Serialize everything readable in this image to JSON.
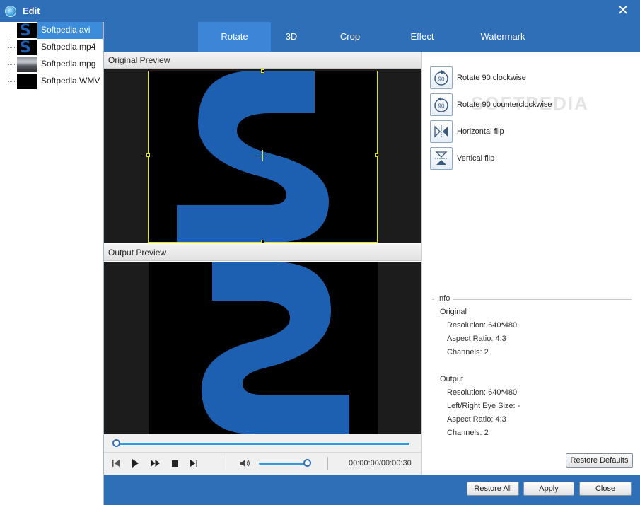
{
  "window": {
    "title": "Edit",
    "close_label": "✕"
  },
  "files": [
    {
      "name": "Softpedia.avi",
      "selected": true,
      "thumb": "s-logo"
    },
    {
      "name": "Softpedia.mp4",
      "selected": false,
      "thumb": "s-logo"
    },
    {
      "name": "Softpedia.mpg",
      "selected": false,
      "thumb": "crowd"
    },
    {
      "name": "Softpedia.WMV",
      "selected": false,
      "thumb": "black"
    }
  ],
  "tabs": [
    {
      "label": "Rotate",
      "active": true
    },
    {
      "label": "3D",
      "active": false
    },
    {
      "label": "Crop",
      "active": false
    },
    {
      "label": "Effect",
      "active": false
    },
    {
      "label": "Watermark",
      "active": false
    }
  ],
  "preview": {
    "original_label": "Original Preview",
    "output_label": "Output Preview"
  },
  "player": {
    "seek_position": 0.0,
    "volume": 1.0,
    "timecode": "00:00:00/00:00:30"
  },
  "rotate_actions": [
    {
      "label": "Rotate 90 clockwise",
      "icon": "rotate-cw-icon"
    },
    {
      "label": "Rotate 90 counterclockwise",
      "icon": "rotate-ccw-icon"
    },
    {
      "label": "Horizontal flip",
      "icon": "horizontal-flip-icon"
    },
    {
      "label": "Vertical flip",
      "icon": "vertical-flip-icon"
    }
  ],
  "watermark_text": "SOFTPEDIA",
  "info": {
    "legend": "Info",
    "original_heading": "Original",
    "original_resolution": "Resolution: 640*480",
    "original_aspect": "Aspect Ratio: 4:3",
    "original_channels": "Channels: 2",
    "output_heading": "Output",
    "output_resolution": "Resolution: 640*480",
    "output_eye_size": "Left/Right Eye Size: -",
    "output_aspect": "Aspect Ratio: 4:3",
    "output_channels": "Channels: 2"
  },
  "buttons": {
    "restore_defaults": "Restore Defaults",
    "restore_all": "Restore All",
    "apply": "Apply",
    "close": "Close"
  },
  "colors": {
    "accent": "#2f6fb8",
    "tab_active": "#3d85d6",
    "logo_blue": "#1d5fb0",
    "crop_frame": "#e6e600"
  }
}
